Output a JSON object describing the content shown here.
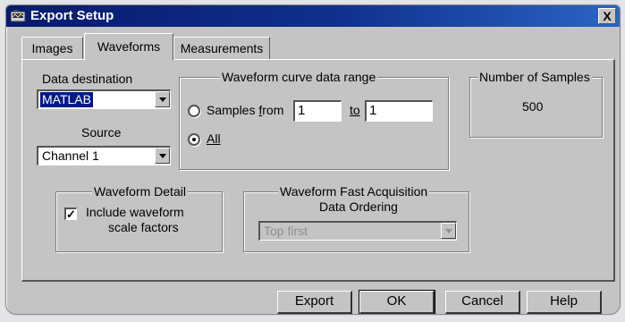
{
  "window": {
    "title": "Export Setup",
    "close_label": "X"
  },
  "tabs": [
    {
      "label": "Images",
      "active": false
    },
    {
      "label": "Waveforms",
      "active": true
    },
    {
      "label": "Measurements",
      "active": false
    }
  ],
  "data_destination": {
    "label": "Data destination",
    "value": "MATLAB"
  },
  "source": {
    "label": "Source",
    "value": "Channel 1"
  },
  "curve_range": {
    "legend": "Waveform curve data range",
    "samples_from_label_pre": "Samples ",
    "samples_from_label_ul": "f",
    "samples_from_label_post": "rom",
    "from_value": "1",
    "to_label": "to",
    "to_value": "1",
    "all_label": "All",
    "selected": "all"
  },
  "num_samples": {
    "legend": "Number of Samples",
    "value": "500"
  },
  "waveform_detail": {
    "legend": "Waveform Detail",
    "checkbox_line1": "Include waveform",
    "checkbox_line2": "scale factors",
    "checked": true
  },
  "fast_acq": {
    "legend": "Waveform Fast Acquisition",
    "sub_label": "Data Ordering",
    "value": "Top first",
    "disabled": true
  },
  "buttons": {
    "export": "Export",
    "ok": "OK",
    "cancel": "Cancel",
    "help": "Help"
  },
  "colors": {
    "titlebar_start": "#071a6b",
    "titlebar_end": "#2b64c6",
    "face": "#c4c4c4",
    "selection": "#001a8a"
  }
}
